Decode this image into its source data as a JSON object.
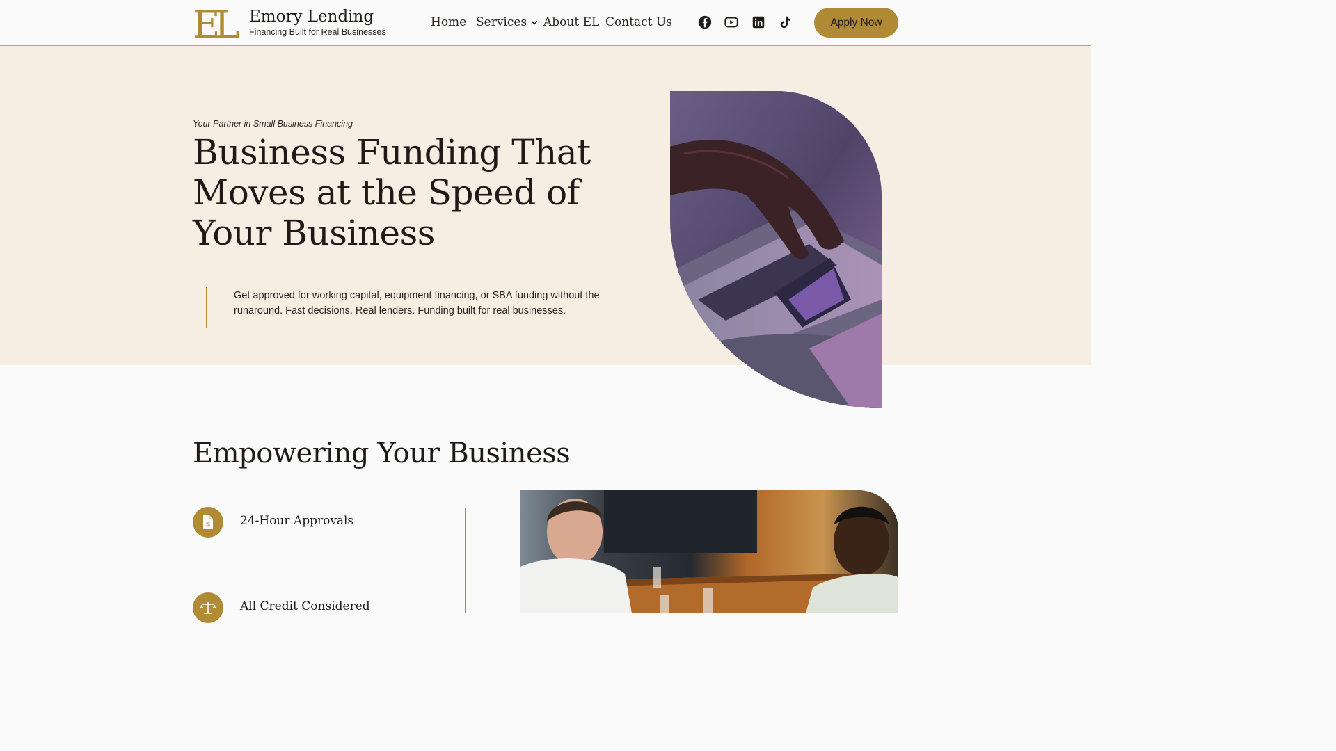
{
  "header": {
    "logo_mark": "EL",
    "brand_name": "Emory Lending",
    "tagline": "Financing Built for Real Businesses",
    "nav": {
      "home": "Home",
      "services": "Services",
      "about": "About EL",
      "contact": "Contact Us"
    },
    "socials": [
      "facebook-icon",
      "youtube-icon",
      "linkedin-icon",
      "tiktok-icon"
    ],
    "apply_label": "Apply Now"
  },
  "hero": {
    "eyebrow": "Your Partner in Small Business Financing",
    "title": "Business Funding That Moves at the Speed of Your Business",
    "text": "Get approved for working capital, equipment financing, or SBA funding without the runaround. Fast decisions. Real lenders. Funding built for real businesses."
  },
  "empower": {
    "title": "Empowering Your Business",
    "features": [
      {
        "label": "24-Hour Approvals",
        "icon": "document-dollar-icon"
      },
      {
        "label": "All Credit Considered",
        "icon": "scale-icon"
      }
    ]
  },
  "colors": {
    "accent": "#b08a35",
    "hero_bg": "#f6eee3",
    "text": "#1f1a17"
  }
}
